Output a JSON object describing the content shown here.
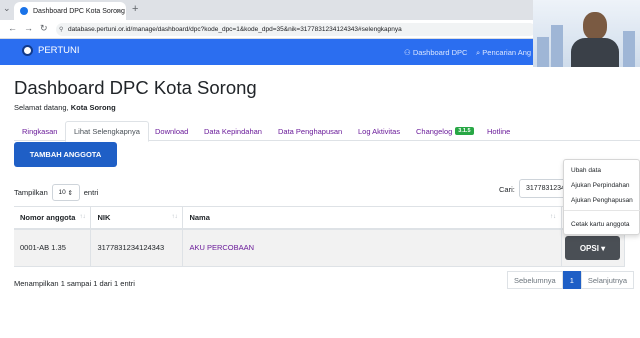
{
  "browser": {
    "tab_title": "Dashboard DPC Kota Sorong",
    "tab_close": "×",
    "new_tab": "+",
    "url": "database.pertuni.or.id/manage/dashboard/dpc?kode_dpc=1&kode_dpd=35&nik=3177831234124343#selengkapnya"
  },
  "navbar": {
    "brand": "PERTUNI",
    "links": [
      "Dashboard DPC",
      "Pencarian Ang"
    ],
    "color": "#2b6ef0"
  },
  "page": {
    "title": "Dashboard DPC Kota Sorong",
    "welcome_prefix": "Selamat datang,",
    "welcome_name": "Kota Sorong"
  },
  "tabs": [
    {
      "label": "Ringkasan"
    },
    {
      "label": "Lihat Selengkapnya",
      "active": true
    },
    {
      "label": "Download"
    },
    {
      "label": "Data Kepindahan"
    },
    {
      "label": "Data Penghapusan"
    },
    {
      "label": "Log Aktivitas"
    },
    {
      "label": "Changelog",
      "badge": "3.1.5"
    },
    {
      "label": "Hotline"
    }
  ],
  "add_button": "TAMBAH ANGGOTA",
  "table_controls": {
    "show_prefix": "Tampilkan",
    "show_value": "10",
    "show_suffix": "entri",
    "search_label": "Cari:",
    "search_value": "3177831234124343"
  },
  "table": {
    "headers": [
      "Nomor anggota",
      "NIK",
      "Nama",
      ""
    ],
    "rows": [
      {
        "nomor": "0001-AB 1.35",
        "nik": "3177831234124343",
        "nama": "AKU PERCOBAAN"
      }
    ]
  },
  "opsi_button": "OPSI ▾",
  "dropdown": {
    "items": [
      "Ubah data",
      "Ajukan Perpindahan",
      "Ajukan Penghapusan",
      "Cetak kartu anggota"
    ]
  },
  "footer": {
    "info": "Menampilkan 1 sampai 1 dari 1 entri",
    "prev": "Sebelumnya",
    "page": "1",
    "next": "Selanjutnya"
  }
}
